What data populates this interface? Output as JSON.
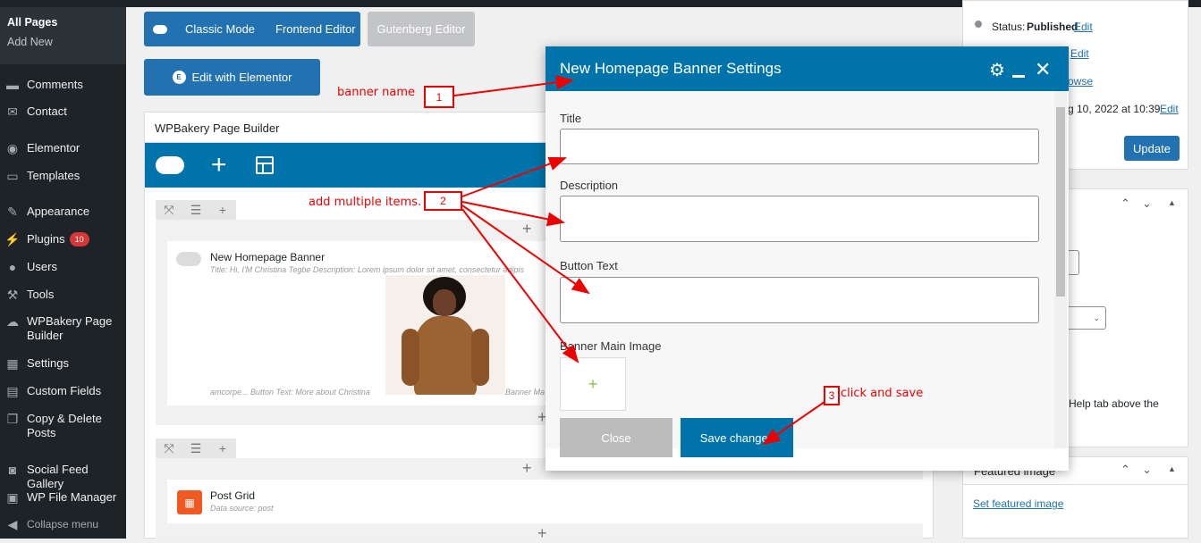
{
  "sidebar": {
    "sub_current": "All Pages",
    "sub_add": "Add New",
    "items": [
      {
        "label": "Comments",
        "icon": "comments-icon"
      },
      {
        "label": "Contact",
        "icon": "mail-icon"
      },
      {
        "label": "Elementor",
        "icon": "elementor-icon"
      },
      {
        "label": "Templates",
        "icon": "folder-icon"
      },
      {
        "label": "Appearance",
        "icon": "brush-icon"
      },
      {
        "label": "Plugins",
        "icon": "plugin-icon",
        "badge": "10"
      },
      {
        "label": "Users",
        "icon": "users-icon"
      },
      {
        "label": "Tools",
        "icon": "wrench-icon"
      },
      {
        "label": "WPBakery Page Builder",
        "icon": "cloud-icon"
      },
      {
        "label": "Settings",
        "icon": "settings-icon"
      },
      {
        "label": "Custom Fields",
        "icon": "fields-icon"
      },
      {
        "label": "Copy & Delete Posts",
        "icon": "copy-icon"
      },
      {
        "label": "Social Feed Gallery",
        "icon": "camera-icon"
      },
      {
        "label": "WP File Manager",
        "icon": "file-manager-icon"
      },
      {
        "label": "Collapse menu",
        "icon": "collapse-icon"
      }
    ]
  },
  "toolbar": {
    "classic": "Classic Mode",
    "frontend": "Frontend Editor",
    "gutenberg": "Gutenberg Editor",
    "elementor": "Edit with Elementor"
  },
  "builder": {
    "title": "WPBakery Page Builder",
    "element1": {
      "name": "New Homepage Banner",
      "meta": "Title: Hi, I'M Christina Tegbe  Description: Lorem ipsum dolor sit amet, consectetur adipis",
      "meta2": "amcorpe...  Button Text: More about Christina",
      "meta3": "Banner Ma"
    },
    "element2": {
      "name": "Post Grid",
      "meta": "Data source: post"
    }
  },
  "publish": {
    "status_label": "Status:",
    "status_value": "Published",
    "edit": "Edit",
    "edit2": "Edit",
    "browse": "owse",
    "date": "g 10, 2022 at 10:39",
    "date_edit": "Edit",
    "update": "Update",
    "help": "Help tab above the",
    "featured_title": "Featured image",
    "featured_link": "Set featured image"
  },
  "modal": {
    "title": "New Homepage Banner Settings",
    "fields": {
      "title": "Title",
      "description": "Description",
      "button_text": "Button Text",
      "image": "Banner Main Image"
    },
    "close": "Close",
    "save": "Save changes"
  },
  "annotations": {
    "a1": "banner name",
    "n1": "1",
    "a2": "add multiple items.",
    "n2": "2",
    "a3": "click and save",
    "n3": "3"
  },
  "colors": {
    "accent": "#0073aa",
    "wp_blue": "#2271b1",
    "annotation": "#e00000"
  }
}
